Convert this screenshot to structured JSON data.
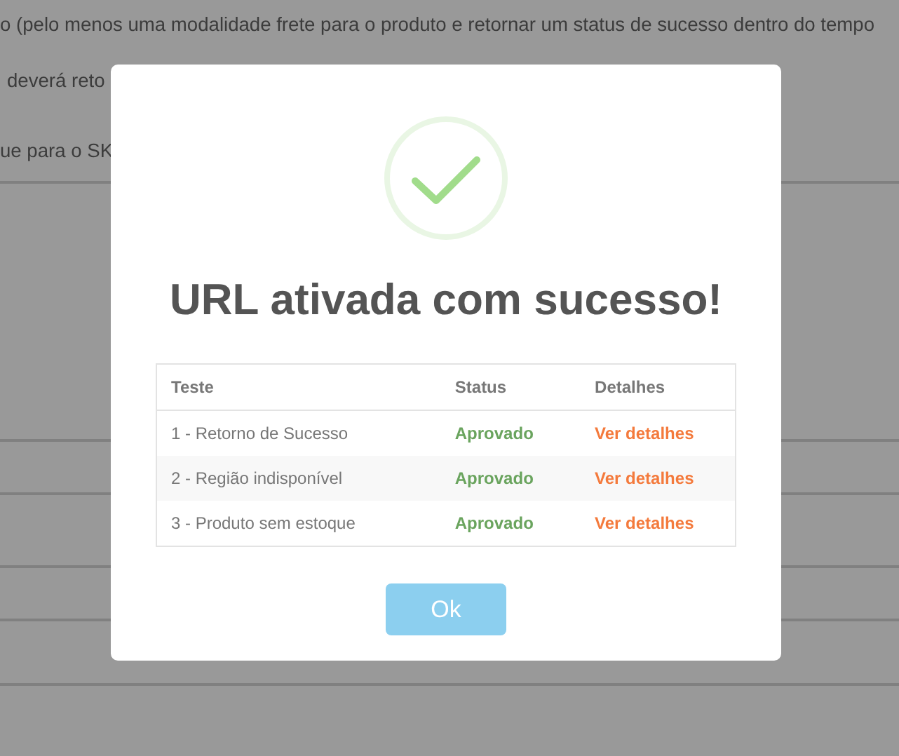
{
  "background": {
    "lines": [
      "o (pelo menos uma modalidade frete para o produto e retornar um status de sucesso dentro do tempo",
      "deverá reto",
      "ue para o SK"
    ]
  },
  "dialog": {
    "title": "URL ativada com sucesso!",
    "table": {
      "columns": [
        "Teste",
        "Status",
        "Detalhes"
      ],
      "rows": [
        {
          "test": "1 - Retorno de Sucesso",
          "status": "Aprovado",
          "details": "Ver detalhes"
        },
        {
          "test": "2 - Região indisponível",
          "status": "Aprovado",
          "details": "Ver detalhes"
        },
        {
          "test": "3 - Produto sem estoque",
          "status": "Aprovado",
          "details": "Ver detalhes"
        }
      ]
    },
    "button": "Ok"
  }
}
